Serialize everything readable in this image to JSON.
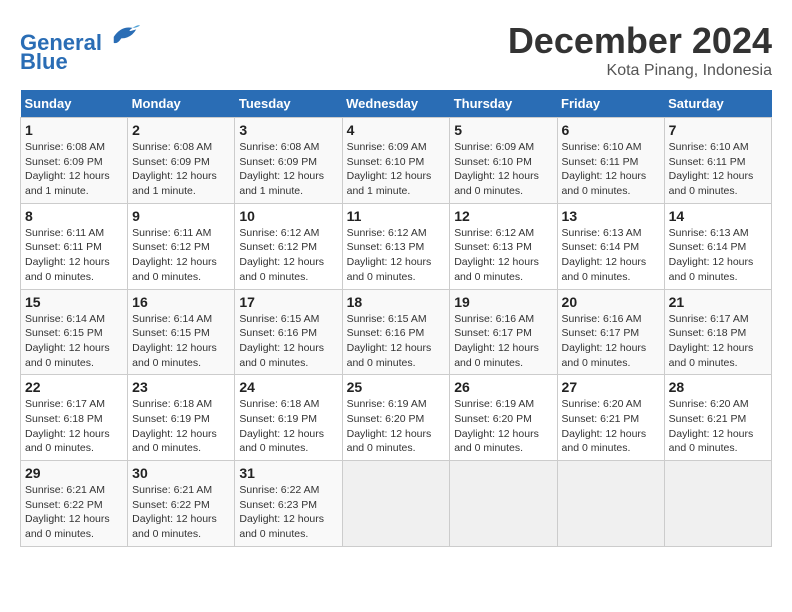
{
  "header": {
    "logo_line1": "General",
    "logo_line2": "Blue",
    "month": "December 2024",
    "location": "Kota Pinang, Indonesia"
  },
  "weekdays": [
    "Sunday",
    "Monday",
    "Tuesday",
    "Wednesday",
    "Thursday",
    "Friday",
    "Saturday"
  ],
  "weeks": [
    [
      {
        "day": "1",
        "info": "Sunrise: 6:08 AM\nSunset: 6:09 PM\nDaylight: 12 hours\nand 1 minute."
      },
      {
        "day": "2",
        "info": "Sunrise: 6:08 AM\nSunset: 6:09 PM\nDaylight: 12 hours\nand 1 minute."
      },
      {
        "day": "3",
        "info": "Sunrise: 6:08 AM\nSunset: 6:09 PM\nDaylight: 12 hours\nand 1 minute."
      },
      {
        "day": "4",
        "info": "Sunrise: 6:09 AM\nSunset: 6:10 PM\nDaylight: 12 hours\nand 1 minute."
      },
      {
        "day": "5",
        "info": "Sunrise: 6:09 AM\nSunset: 6:10 PM\nDaylight: 12 hours\nand 0 minutes."
      },
      {
        "day": "6",
        "info": "Sunrise: 6:10 AM\nSunset: 6:11 PM\nDaylight: 12 hours\nand 0 minutes."
      },
      {
        "day": "7",
        "info": "Sunrise: 6:10 AM\nSunset: 6:11 PM\nDaylight: 12 hours\nand 0 minutes."
      }
    ],
    [
      {
        "day": "8",
        "info": "Sunrise: 6:11 AM\nSunset: 6:11 PM\nDaylight: 12 hours\nand 0 minutes."
      },
      {
        "day": "9",
        "info": "Sunrise: 6:11 AM\nSunset: 6:12 PM\nDaylight: 12 hours\nand 0 minutes."
      },
      {
        "day": "10",
        "info": "Sunrise: 6:12 AM\nSunset: 6:12 PM\nDaylight: 12 hours\nand 0 minutes."
      },
      {
        "day": "11",
        "info": "Sunrise: 6:12 AM\nSunset: 6:13 PM\nDaylight: 12 hours\nand 0 minutes."
      },
      {
        "day": "12",
        "info": "Sunrise: 6:12 AM\nSunset: 6:13 PM\nDaylight: 12 hours\nand 0 minutes."
      },
      {
        "day": "13",
        "info": "Sunrise: 6:13 AM\nSunset: 6:14 PM\nDaylight: 12 hours\nand 0 minutes."
      },
      {
        "day": "14",
        "info": "Sunrise: 6:13 AM\nSunset: 6:14 PM\nDaylight: 12 hours\nand 0 minutes."
      }
    ],
    [
      {
        "day": "15",
        "info": "Sunrise: 6:14 AM\nSunset: 6:15 PM\nDaylight: 12 hours\nand 0 minutes."
      },
      {
        "day": "16",
        "info": "Sunrise: 6:14 AM\nSunset: 6:15 PM\nDaylight: 12 hours\nand 0 minutes."
      },
      {
        "day": "17",
        "info": "Sunrise: 6:15 AM\nSunset: 6:16 PM\nDaylight: 12 hours\nand 0 minutes."
      },
      {
        "day": "18",
        "info": "Sunrise: 6:15 AM\nSunset: 6:16 PM\nDaylight: 12 hours\nand 0 minutes."
      },
      {
        "day": "19",
        "info": "Sunrise: 6:16 AM\nSunset: 6:17 PM\nDaylight: 12 hours\nand 0 minutes."
      },
      {
        "day": "20",
        "info": "Sunrise: 6:16 AM\nSunset: 6:17 PM\nDaylight: 12 hours\nand 0 minutes."
      },
      {
        "day": "21",
        "info": "Sunrise: 6:17 AM\nSunset: 6:18 PM\nDaylight: 12 hours\nand 0 minutes."
      }
    ],
    [
      {
        "day": "22",
        "info": "Sunrise: 6:17 AM\nSunset: 6:18 PM\nDaylight: 12 hours\nand 0 minutes."
      },
      {
        "day": "23",
        "info": "Sunrise: 6:18 AM\nSunset: 6:19 PM\nDaylight: 12 hours\nand 0 minutes."
      },
      {
        "day": "24",
        "info": "Sunrise: 6:18 AM\nSunset: 6:19 PM\nDaylight: 12 hours\nand 0 minutes."
      },
      {
        "day": "25",
        "info": "Sunrise: 6:19 AM\nSunset: 6:20 PM\nDaylight: 12 hours\nand 0 minutes."
      },
      {
        "day": "26",
        "info": "Sunrise: 6:19 AM\nSunset: 6:20 PM\nDaylight: 12 hours\nand 0 minutes."
      },
      {
        "day": "27",
        "info": "Sunrise: 6:20 AM\nSunset: 6:21 PM\nDaylight: 12 hours\nand 0 minutes."
      },
      {
        "day": "28",
        "info": "Sunrise: 6:20 AM\nSunset: 6:21 PM\nDaylight: 12 hours\nand 0 minutes."
      }
    ],
    [
      {
        "day": "29",
        "info": "Sunrise: 6:21 AM\nSunset: 6:22 PM\nDaylight: 12 hours\nand 0 minutes."
      },
      {
        "day": "30",
        "info": "Sunrise: 6:21 AM\nSunset: 6:22 PM\nDaylight: 12 hours\nand 0 minutes."
      },
      {
        "day": "31",
        "info": "Sunrise: 6:22 AM\nSunset: 6:23 PM\nDaylight: 12 hours\nand 0 minutes."
      },
      {
        "day": "",
        "info": ""
      },
      {
        "day": "",
        "info": ""
      },
      {
        "day": "",
        "info": ""
      },
      {
        "day": "",
        "info": ""
      }
    ]
  ]
}
